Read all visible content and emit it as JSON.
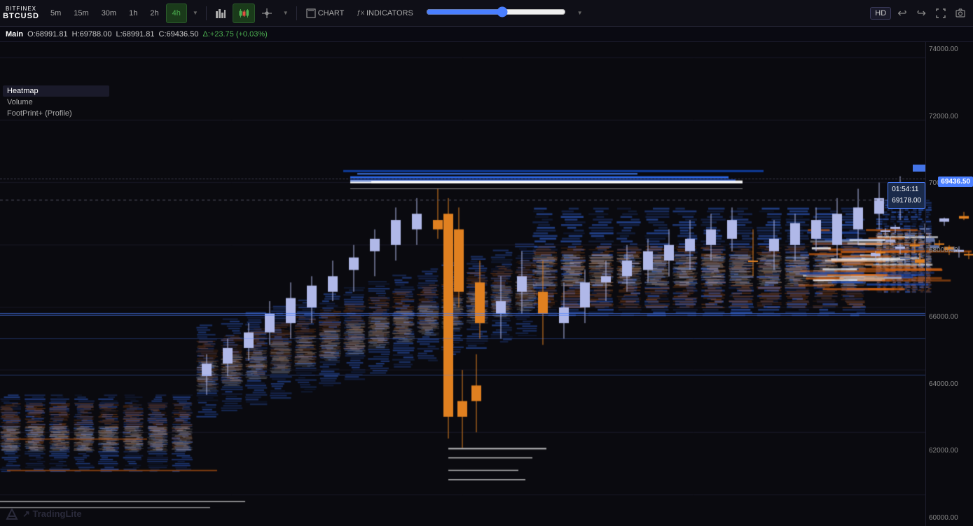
{
  "app": {
    "exchange": "BITFINEX",
    "pair": "BTCUSD",
    "watermark": "↗ TradingLite"
  },
  "toolbar": {
    "intervals": [
      "5m",
      "15m",
      "30m",
      "1h",
      "2h",
      "4h"
    ],
    "active_interval": "4h",
    "chart_type_label": "CHART",
    "indicators_label": "INDICATORS",
    "hd_label": "HD",
    "undo_label": "↩",
    "redo_label": "↪",
    "fullscreen_label": "⛶",
    "camera_label": "📷"
  },
  "info_bar": {
    "label": "Main",
    "open_label": "O:",
    "open_val": "68991.81",
    "high_label": "H:",
    "high_val": "69788.00",
    "low_label": "L:",
    "low_val": "68991.81",
    "close_label": "C:",
    "close_val": "69436.50",
    "delta_label": "Δ:+23.75 (+0.03%)"
  },
  "indicators": [
    {
      "id": "main",
      "label": "Main"
    },
    {
      "id": "heatmap",
      "label": "Heatmap"
    },
    {
      "id": "volume",
      "label": "Volume"
    },
    {
      "id": "footprint",
      "label": "FootPrint+ (Profile)"
    }
  ],
  "price_axis": {
    "levels": [
      {
        "price": "74000.00",
        "pct": 0
      },
      {
        "price": "72000.00",
        "pct": 14
      },
      {
        "price": "70000.00",
        "pct": 30
      },
      {
        "price": "68000.00",
        "pct": 46
      },
      {
        "price": "66000.00",
        "pct": 57
      },
      {
        "price": "64000.00",
        "pct": 68
      },
      {
        "price": "62000.00",
        "pct": 80
      },
      {
        "price": "60000.00",
        "pct": 91
      }
    ],
    "current_price": "69436.50",
    "current_price_pct": 34,
    "tooltip_time": "01:54:11",
    "tooltip_price": "69178.00"
  },
  "colors": {
    "background": "#0a0a0f",
    "toolbar_bg": "#0f0f17",
    "accent_blue": "#4a7fff",
    "bullish": "#b0b8e8",
    "bearish_orange": "#e08020",
    "heatmap_hot": "#e07020",
    "heatmap_cold": "#3060c0",
    "grid_line": "#1a1a28",
    "text_dim": "#666677"
  }
}
